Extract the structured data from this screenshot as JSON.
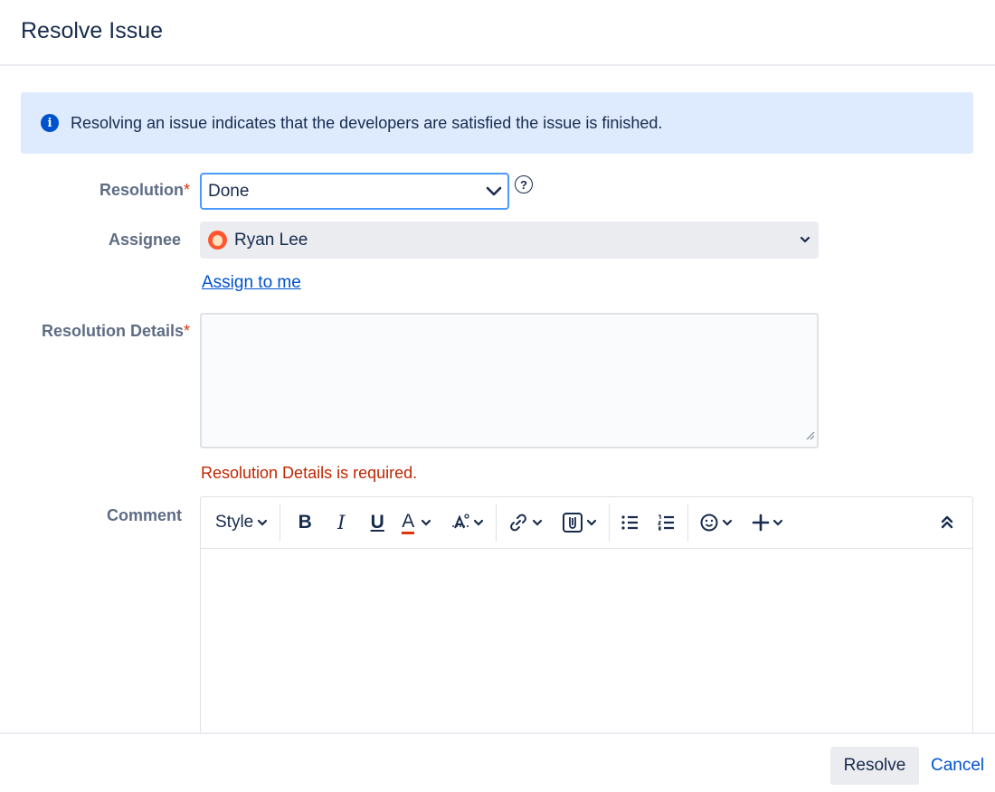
{
  "dialog": {
    "title": "Resolve Issue"
  },
  "info": {
    "text": "Resolving an issue indicates that the developers are satisfied the issue is finished."
  },
  "form": {
    "resolution": {
      "label": "Resolution",
      "required_mark": "*",
      "value": "Done"
    },
    "assignee": {
      "label": "Assignee",
      "value": "Ryan Lee",
      "assign_to_me": "Assign to me"
    },
    "resolution_details": {
      "label": "Resolution Details",
      "required_mark": "*",
      "value": "",
      "error": "Resolution Details is required."
    },
    "comment": {
      "label": "Comment"
    }
  },
  "toolbar": {
    "style_label": "Style",
    "bold": "B",
    "italic": "I",
    "underline": "U",
    "text_color": "A",
    "text_color_underline": "#de350b"
  },
  "footer": {
    "resolve_label": "Resolve",
    "cancel_label": "Cancel"
  },
  "colors": {
    "accent": "#0052cc",
    "error": "#bf2600",
    "info_bg": "#deebff",
    "focus": "#4c9aff"
  }
}
